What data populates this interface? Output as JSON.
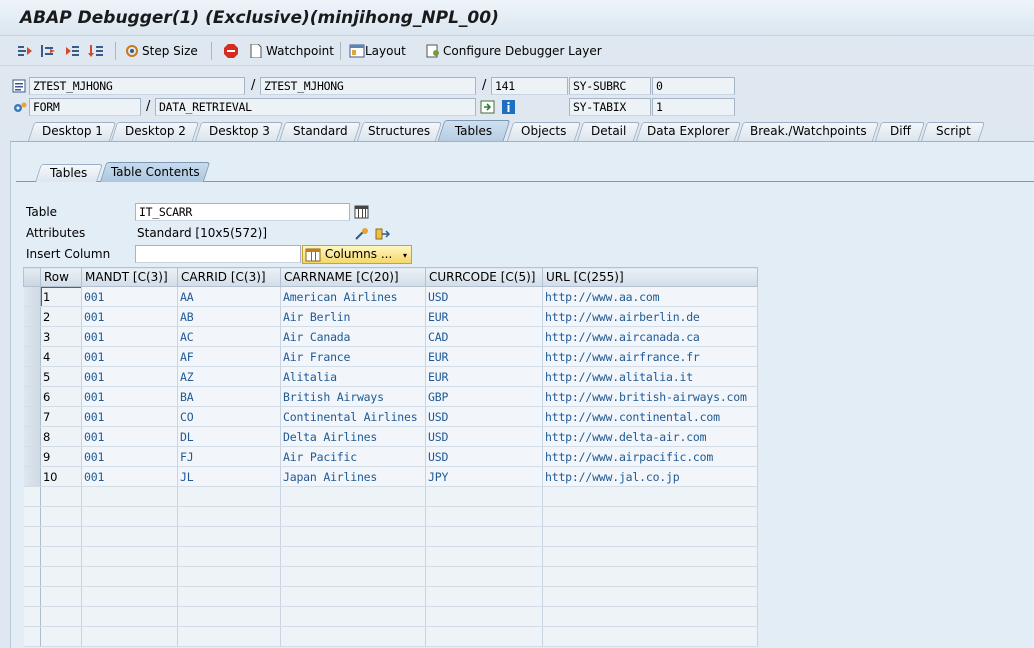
{
  "window": {
    "title": "ABAP Debugger(1)  (Exclusive)(minjihong_NPL_00)"
  },
  "toolbar": {
    "step_size": "Step Size",
    "watchpoint": "Watchpoint",
    "layout": "Layout",
    "configure_layer": "Configure Debugger Layer"
  },
  "header": {
    "program": "ZTEST_MJHONG",
    "include": "ZTEST_MJHONG",
    "line": "141",
    "sy_subrc_label": "SY-SUBRC",
    "sy_subrc_value": "0",
    "event_type": "FORM",
    "event_name": "DATA_RETRIEVAL",
    "sy_tabix_label": "SY-TABIX",
    "sy_tabix_value": "1"
  },
  "tabs": [
    {
      "label": "Desktop 1"
    },
    {
      "label": "Desktop 2"
    },
    {
      "label": "Desktop 3"
    },
    {
      "label": "Standard"
    },
    {
      "label": "Structures"
    },
    {
      "label": "Tables"
    },
    {
      "label": "Objects"
    },
    {
      "label": "Detail"
    },
    {
      "label": "Data Explorer"
    },
    {
      "label": "Break./Watchpoints"
    },
    {
      "label": "Diff"
    },
    {
      "label": "Script"
    }
  ],
  "active_tab": "Tables",
  "subtabs": [
    {
      "label": "Tables"
    },
    {
      "label": "Table Contents"
    }
  ],
  "form": {
    "table_label": "Table",
    "table_value": "IT_SCARR",
    "attributes_label": "Attributes",
    "attributes_value": "Standard [10x5(572)]",
    "insert_column_label": "Insert Column",
    "insert_column_value": "",
    "columns_button": "Columns ..."
  },
  "grid": {
    "headers": [
      "Row",
      "MANDT [C(3)]",
      "CARRID [C(3)]",
      "CARRNAME [C(20)]",
      "CURRCODE [C(5)]",
      "URL [C(255)]"
    ],
    "rows": [
      [
        "1",
        "001",
        "AA",
        "American Airlines",
        "USD",
        "http://www.aa.com"
      ],
      [
        "2",
        "001",
        "AB",
        "Air Berlin",
        "EUR",
        "http://www.airberlin.de"
      ],
      [
        "3",
        "001",
        "AC",
        "Air Canada",
        "CAD",
        "http://www.aircanada.ca"
      ],
      [
        "4",
        "001",
        "AF",
        "Air France",
        "EUR",
        "http://www.airfrance.fr"
      ],
      [
        "5",
        "001",
        "AZ",
        "Alitalia",
        "EUR",
        "http://www.alitalia.it"
      ],
      [
        "6",
        "001",
        "BA",
        "British Airways",
        "GBP",
        "http://www.british-airways.com"
      ],
      [
        "7",
        "001",
        "CO",
        "Continental Airlines",
        "USD",
        "http://www.continental.com"
      ],
      [
        "8",
        "001",
        "DL",
        "Delta Airlines",
        "USD",
        "http://www.delta-air.com"
      ],
      [
        "9",
        "001",
        "FJ",
        "Air Pacific",
        "USD",
        "http://www.airpacific.com"
      ],
      [
        "10",
        "001",
        "JL",
        "Japan Airlines",
        "JPY",
        "http://www.jal.co.jp"
      ]
    ]
  },
  "colors": {
    "value_text": "#1f5a96",
    "background": "#dfe8f1",
    "columns_button": "#f5d76a"
  }
}
